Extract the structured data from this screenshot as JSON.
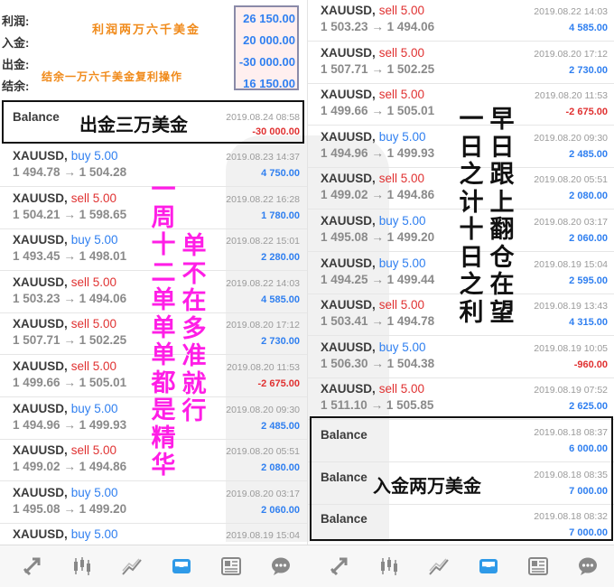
{
  "summary": {
    "labels": [
      "利润:",
      "入金:",
      "出金:",
      "结余:"
    ],
    "values": [
      "26 150.00",
      "20 000.00",
      "-30 000.00",
      "16 150.00"
    ],
    "annotation_profit": "利润两万六千美金",
    "annotation_balance": "结余一万六千美金复利操作"
  },
  "left": {
    "withdraw": {
      "label": "Balance",
      "date": "2019.08.24 08:58",
      "amount": "-30 000.00",
      "caption": "出金三万美金"
    },
    "trades": [
      {
        "symbol": "XAUUSD,",
        "side": "buy 5.00",
        "type": "buy",
        "open": "1 494.78",
        "close": "1 504.28",
        "date": "2019.08.23 14:37",
        "profit": "4 750.00",
        "sign": "pos"
      },
      {
        "symbol": "XAUUSD,",
        "side": "sell 5.00",
        "type": "sell",
        "open": "1 504.21",
        "close": "1 598.65",
        "date": "2019.08.22 16:28",
        "profit": "1 780.00",
        "sign": "pos"
      },
      {
        "symbol": "XAUUSD,",
        "side": "buy 5.00",
        "type": "buy",
        "open": "1 493.45",
        "close": "1 498.01",
        "date": "2019.08.22 15:01",
        "profit": "2 280.00",
        "sign": "pos"
      },
      {
        "symbol": "XAUUSD,",
        "side": "sell 5.00",
        "type": "sell",
        "open": "1 503.23",
        "close": "1 494.06",
        "date": "2019.08.22 14:03",
        "profit": "4 585.00",
        "sign": "pos"
      },
      {
        "symbol": "XAUUSD,",
        "side": "sell 5.00",
        "type": "sell",
        "open": "1 507.71",
        "close": "1 502.25",
        "date": "2019.08.20 17:12",
        "profit": "2 730.00",
        "sign": "pos"
      },
      {
        "symbol": "XAUUSD,",
        "side": "sell 5.00",
        "type": "sell",
        "open": "1 499.66",
        "close": "1 505.01",
        "date": "2019.08.20 11:53",
        "profit": "-2 675.00",
        "sign": "neg"
      },
      {
        "symbol": "XAUUSD,",
        "side": "buy 5.00",
        "type": "buy",
        "open": "1 494.96",
        "close": "1 499.93",
        "date": "2019.08.20 09:30",
        "profit": "2 485.00",
        "sign": "pos"
      },
      {
        "symbol": "XAUUSD,",
        "side": "sell 5.00",
        "type": "sell",
        "open": "1 499.02",
        "close": "1 494.86",
        "date": "2019.08.20 05:51",
        "profit": "2 080.00",
        "sign": "pos"
      },
      {
        "symbol": "XAUUSD,",
        "side": "buy 5.00",
        "type": "buy",
        "open": "1 495.08",
        "close": "1 499.20",
        "date": "2019.08.20 03:17",
        "profit": "2 060.00",
        "sign": "pos"
      },
      {
        "symbol": "XAUUSD,",
        "side": "buy 5.00",
        "type": "buy",
        "open": "",
        "close": "",
        "date": "2019.08.19 15:04",
        "profit": "",
        "sign": "pos"
      }
    ],
    "annotation_magenta": [
      "一周十二单单单都是精华",
      "单不在多准就行"
    ]
  },
  "right": {
    "trades": [
      {
        "symbol": "XAUUSD,",
        "side": "sell 5.00",
        "type": "sell",
        "open": "1 503.23",
        "close": "1 494.06",
        "date": "2019.08.22 14:03",
        "profit": "4 585.00",
        "sign": "pos"
      },
      {
        "symbol": "XAUUSD,",
        "side": "sell 5.00",
        "type": "sell",
        "open": "1 507.71",
        "close": "1 502.25",
        "date": "2019.08.20 17:12",
        "profit": "2 730.00",
        "sign": "pos"
      },
      {
        "symbol": "XAUUSD,",
        "side": "sell 5.00",
        "type": "sell",
        "open": "1 499.66",
        "close": "1 505.01",
        "date": "2019.08.20 11:53",
        "profit": "-2 675.00",
        "sign": "neg"
      },
      {
        "symbol": "XAUUSD,",
        "side": "buy 5.00",
        "type": "buy",
        "open": "1 494.96",
        "close": "1 499.93",
        "date": "2019.08.20 09:30",
        "profit": "2 485.00",
        "sign": "pos"
      },
      {
        "symbol": "XAUUSD,",
        "side": "sell 5.00",
        "type": "sell",
        "open": "1 499.02",
        "close": "1 494.86",
        "date": "2019.08.20 05:51",
        "profit": "2 080.00",
        "sign": "pos"
      },
      {
        "symbol": "XAUUSD,",
        "side": "buy 5.00",
        "type": "buy",
        "open": "1 495.08",
        "close": "1 499.20",
        "date": "2019.08.20 03:17",
        "profit": "2 060.00",
        "sign": "pos"
      },
      {
        "symbol": "XAUUSD,",
        "side": "buy 5.00",
        "type": "buy",
        "open": "1 494.25",
        "close": "1 499.44",
        "date": "2019.08.19 15:04",
        "profit": "2 595.00",
        "sign": "pos"
      },
      {
        "symbol": "XAUUSD,",
        "side": "sell 5.00",
        "type": "sell",
        "open": "1 503.41",
        "close": "1 494.78",
        "date": "2019.08.19 13:43",
        "profit": "4 315.00",
        "sign": "pos"
      },
      {
        "symbol": "XAUUSD,",
        "side": "buy 5.00",
        "type": "buy",
        "open": "1 506.30",
        "close": "1 504.38",
        "date": "2019.08.19 10:05",
        "profit": "-960.00",
        "sign": "neg"
      },
      {
        "symbol": "XAUUSD,",
        "side": "sell 5.00",
        "type": "sell",
        "open": "1 511.10",
        "close": "1 505.85",
        "date": "2019.08.19 07:52",
        "profit": "2 625.00",
        "sign": "pos"
      }
    ],
    "deposits": [
      {
        "label": "Balance",
        "date": "2019.08.18 08:37",
        "amount": "6 000.00"
      },
      {
        "label": "Balance",
        "date": "2019.08.18 08:35",
        "amount": "7 000.00"
      },
      {
        "label": "Balance",
        "date": "2019.08.18 08:32",
        "amount": "7 000.00"
      }
    ],
    "deposit_caption": "入金两万美金",
    "annotation_black": [
      "早日跟上翻仓在望",
      "一日之计十日之利"
    ]
  },
  "arrow": "→",
  "toolbar": {
    "icons": [
      "trade-icon",
      "candlestick-chart-icon",
      "trend-chart-icon",
      "history-inbox-icon",
      "news-icon",
      "chat-icon"
    ]
  },
  "colors": {
    "buy": "#2f7ff0",
    "sell": "#e03131",
    "annotation_magenta": "#ff1ee6",
    "annotation_orange": "#f08a1a"
  }
}
